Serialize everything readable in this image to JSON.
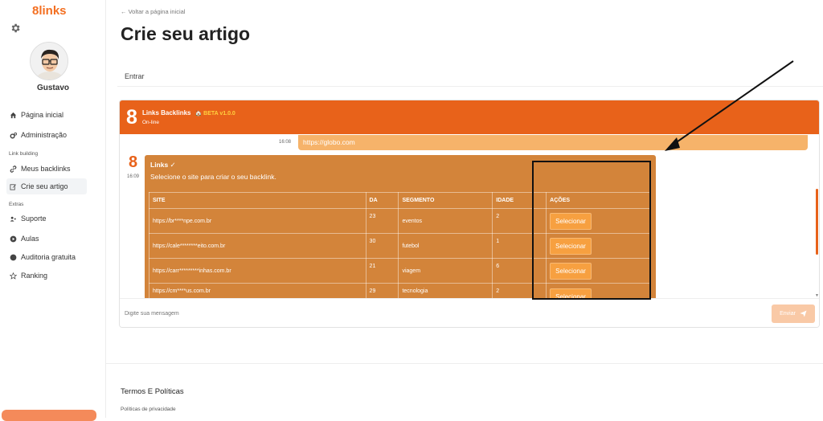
{
  "sidebar": {
    "logo": "8links",
    "username": "Gustavo",
    "items": [
      {
        "label": "Página inicial",
        "icon": "home-icon"
      },
      {
        "label": "Administração",
        "icon": "cogs-icon"
      },
      {
        "label": "Meus backlinks",
        "icon": "link-icon"
      },
      {
        "label": "Crie seu artigo",
        "icon": "edit-icon"
      },
      {
        "label": "Suporte",
        "icon": "support-icon"
      },
      {
        "label": "Aulas",
        "icon": "play-icon"
      },
      {
        "label": "Auditoria gratuita",
        "icon": "globe-icon"
      },
      {
        "label": "Ranking",
        "icon": "star-icon"
      }
    ],
    "sections": {
      "link_building": "Link building",
      "extras": "Extras"
    }
  },
  "main": {
    "back_link": "← Voltar a página inicial",
    "title": "Crie seu artigo",
    "tab": "Entrar"
  },
  "chat": {
    "header": {
      "logo": "8",
      "name": "Links Backlinks",
      "badge": "🏠 BETA v1.0.0",
      "status": "On-line"
    },
    "outgoing": {
      "text": "https://globo.com",
      "time": "16:08"
    },
    "bot": {
      "logo": "8",
      "time": "16:09",
      "title": "Links ✓",
      "subtitle": "Selecione o site para criar o seu backlink."
    },
    "table": {
      "headers": [
        "SITE",
        "DA",
        "SEGMENTO",
        "IDADE",
        "AÇÕES"
      ],
      "rows": [
        {
          "site": "https://br****npe.com.br",
          "da": "23",
          "segmento": "eventos",
          "idade": "2",
          "acao": "Selecionar"
        },
        {
          "site": "https://cale********eito.com.br",
          "da": "30",
          "segmento": "futebol",
          "idade": "1",
          "acao": "Selecionar"
        },
        {
          "site": "https://carr*********inhas.com.br",
          "da": "21",
          "segmento": "viagem",
          "idade": "6",
          "acao": "Selecionar"
        },
        {
          "site": "https://cm****us.com.br",
          "da": "29",
          "segmento": "tecnologia",
          "idade": "2",
          "acao": "Selecionar"
        }
      ]
    },
    "input_placeholder": "Digite sua mensagem",
    "send_label": "Enviar"
  },
  "footer": {
    "title": "Termos E Políticas",
    "link": "Políticas de privacidade"
  },
  "colors": {
    "brand": "#e8621a",
    "logo_text": "#f36f21",
    "bubble": "#d3843a",
    "outgoing": "#f6b36a"
  }
}
